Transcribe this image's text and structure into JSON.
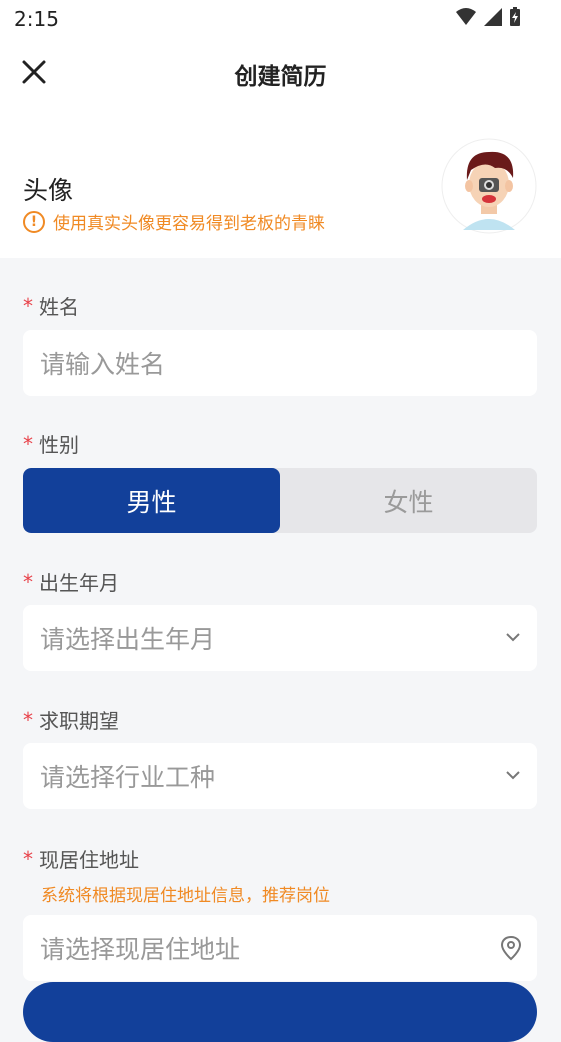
{
  "status": {
    "time": "2:15"
  },
  "header": {
    "title": "创建简历"
  },
  "avatar": {
    "label": "头像",
    "tip": "使用真实头像更容易得到老板的青睐"
  },
  "form": {
    "name": {
      "label": "姓名",
      "placeholder": "请输入姓名"
    },
    "gender": {
      "label": "性别",
      "options": [
        "男性",
        "女性"
      ],
      "selected": "男性"
    },
    "birth": {
      "label": "出生年月",
      "placeholder": "请选择出生年月"
    },
    "job": {
      "label": "求职期望",
      "placeholder": "请选择行业工种"
    },
    "address": {
      "label": "现居住地址",
      "hint": "系统将根据现居住地址信息，推荐岗位",
      "placeholder": "请选择现居住地址"
    }
  },
  "colors": {
    "primary": "#12409a",
    "warning": "#f08a24",
    "required": "#e8424a"
  }
}
